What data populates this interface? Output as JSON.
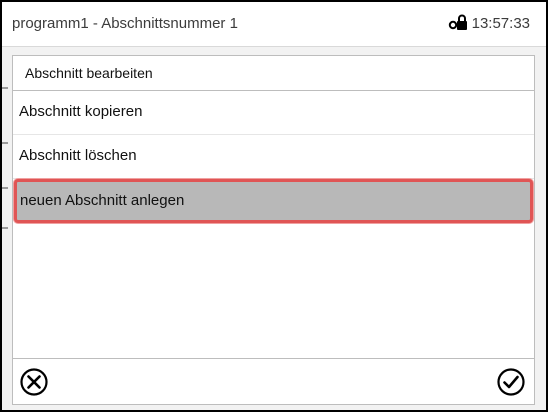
{
  "header": {
    "title": "programm1 - Abschnittsnummer 1",
    "time": "13:57:33",
    "status_icon": "lock-icon"
  },
  "menu": {
    "title": "Abschnitt bearbeiten",
    "items": [
      {
        "label": "Abschnitt kopieren",
        "selected": false
      },
      {
        "label": "Abschnitt löschen",
        "selected": false
      },
      {
        "label": "neuen Abschnitt anlegen",
        "selected": true
      }
    ]
  },
  "footer": {
    "cancel_icon": "cancel-circle-x-icon",
    "confirm_icon": "confirm-circle-check-icon"
  },
  "colors": {
    "selection_bg": "#b8b8b8",
    "selection_border": "#e05555"
  }
}
